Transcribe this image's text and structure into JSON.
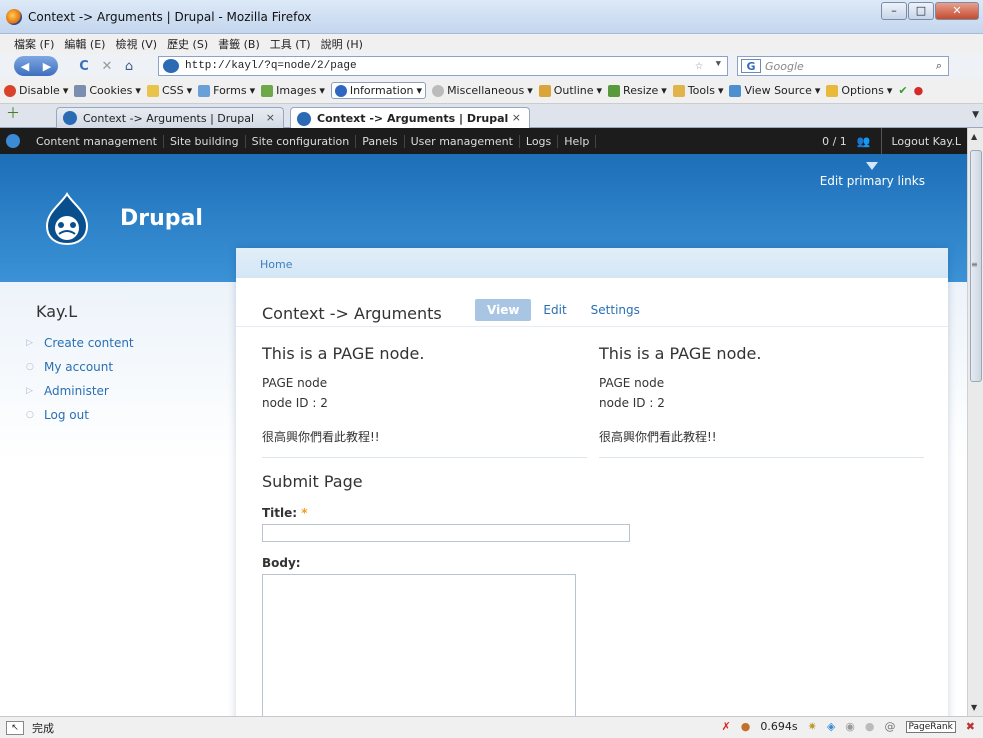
{
  "window": {
    "title": "Context -> Arguments | Drupal - Mozilla Firefox",
    "btn_min": "–",
    "btn_max": "□",
    "btn_close": "✕"
  },
  "menu": [
    "檔案 (F)",
    "編輯 (E)",
    "檢視 (V)",
    "歷史 (S)",
    "書籤 (B)",
    "工具 (T)",
    "說明 (H)"
  ],
  "nav": {
    "back_glyph": "◀",
    "fwd_glyph": "▶",
    "reload_glyph": "C",
    "stop_glyph": "✕",
    "home_glyph": "⌂",
    "url": "http://kayl/?q=node/2/page",
    "search_placeholder": "Google",
    "search_engine": "G"
  },
  "devbar": {
    "items": [
      "Disable",
      "Cookies",
      "CSS",
      "Forms",
      "Images",
      "Information",
      "Miscellaneous",
      "Outline",
      "Resize",
      "Tools",
      "View Source",
      "Options"
    ]
  },
  "tabs": [
    {
      "label": "Context -> Arguments | Drupal",
      "close": "×"
    },
    {
      "label": "Context -> Arguments | Drupal",
      "close": "×"
    }
  ],
  "admin_menu": {
    "items": [
      "Content management",
      "Site building",
      "Site configuration",
      "Panels",
      "User management",
      "Logs",
      "Help"
    ],
    "users": "0 / 1",
    "logout": "Logout Kay.L"
  },
  "site": {
    "name": "Drupal",
    "edit_primary_links": "Edit primary links"
  },
  "breadcrumb": "Home",
  "sidebar": {
    "user": "Kay.L",
    "items": [
      "Create content",
      "My account",
      "Administer",
      "Log out"
    ]
  },
  "node": {
    "title": "Context -> Arguments",
    "tabs": {
      "view": "View",
      "edit": "Edit",
      "settings": "Settings"
    },
    "columns": [
      {
        "heading": "This is a PAGE node.",
        "type": "PAGE node",
        "node_id": "node ID : 2",
        "text": "很高興你們看此教程!!"
      },
      {
        "heading": "This is a PAGE node.",
        "type": "PAGE node",
        "node_id": "node ID : 2",
        "text": "很高興你們看此教程!!"
      }
    ]
  },
  "form": {
    "heading": "Submit Page",
    "title_label": "Title:",
    "required_mark": "*",
    "body_label": "Body:"
  },
  "status": {
    "text": "完成",
    "timing": "0.694s",
    "pagerank": "PageRank"
  }
}
